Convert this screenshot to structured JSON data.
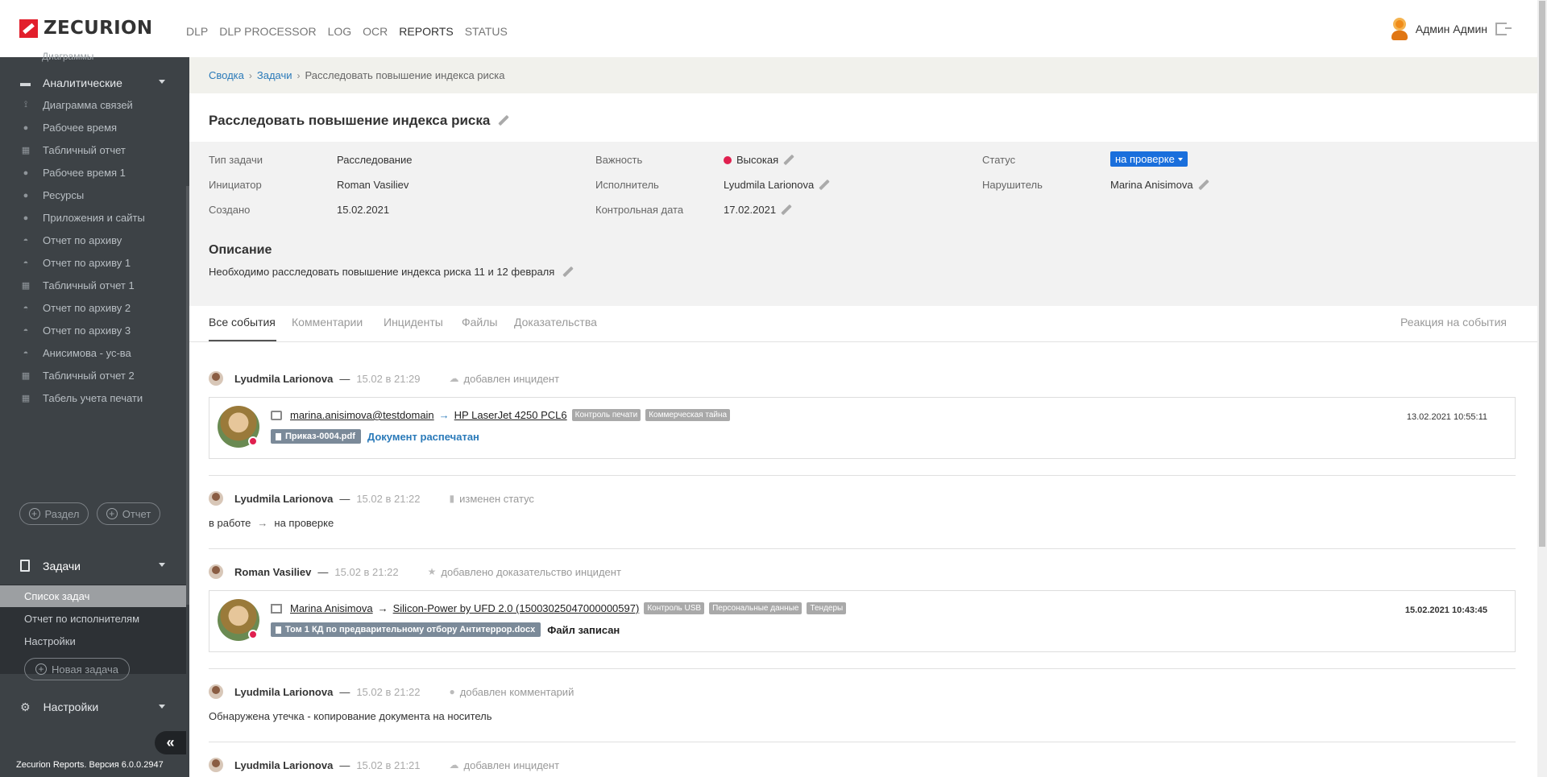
{
  "app": {
    "brand": "ZECURION",
    "brand_color": "#e21f2c"
  },
  "topnav": [
    "DLP",
    "DLP PROCESSOR",
    "LOG",
    "OCR",
    "REPORTS",
    "STATUS"
  ],
  "topnav_active": "REPORTS",
  "user": {
    "name": "Админ Админ"
  },
  "sidebar": {
    "cut_item": "Диаграммы",
    "group_analytics": "Аналитические",
    "items": [
      {
        "label": "Диаграмма связей",
        "icon": "graph-icon"
      },
      {
        "label": "Рабочее время",
        "icon": "clock-icon"
      },
      {
        "label": "Табличный отчет",
        "icon": "table-icon"
      },
      {
        "label": "Рабочее время 1",
        "icon": "clock-icon"
      },
      {
        "label": "Ресурсы",
        "icon": "users-icon"
      },
      {
        "label": "Приложения и сайты",
        "icon": "users-icon"
      },
      {
        "label": "Отчет по архиву",
        "icon": "archive-icon"
      },
      {
        "label": "Отчет по архиву 1",
        "icon": "archive-icon"
      },
      {
        "label": "Табличный отчет 1",
        "icon": "table-icon"
      },
      {
        "label": "Отчет по архиву 2",
        "icon": "archive-icon"
      },
      {
        "label": "Отчет по архиву 3",
        "icon": "archive-icon"
      },
      {
        "label": "Анисимова - ус-ва",
        "icon": "archive-icon"
      },
      {
        "label": "Табличный отчет 2",
        "icon": "table-icon"
      },
      {
        "label": "Табель учета печати",
        "icon": "grid-icon"
      }
    ],
    "add_section": "Раздел",
    "add_report": "Отчет",
    "tasks_group": "Задачи",
    "tasks_items": [
      "Список задач",
      "Отчет по исполнителям",
      "Настройки"
    ],
    "new_task": "Новая задача",
    "settings_group": "Настройки",
    "version": "Zecurion Reports. Версия 6.0.0.2947"
  },
  "breadcrumb": {
    "root": "Сводка",
    "parent": "Задачи",
    "current": "Расследовать повышение индекса риска"
  },
  "task": {
    "title": "Расследовать повышение индекса риска",
    "type_label": "Тип задачи",
    "type": "Расследование",
    "initiator_label": "Инициатор",
    "initiator": "Roman Vasiliev",
    "created_label": "Создано",
    "created": "15.02.2021",
    "priority_label": "Важность",
    "priority": "Высокая",
    "assignee_label": "Исполнитель",
    "assignee": "Lyudmila Larionova",
    "deadline_label": "Контрольная дата",
    "deadline": "17.02.2021",
    "status_label": "Статус",
    "status": "на проверке",
    "violator_label": "Нарушитель",
    "violator": "Marina Anisimova",
    "description_title": "Описание",
    "description": "Необходимо расследовать повышение индекса риска 11 и 12 февраля"
  },
  "tabs": [
    "Все события",
    "Комментарии",
    "Инциденты",
    "Файлы",
    "Доказательства"
  ],
  "tab_right": "Реакция на события",
  "events": [
    {
      "author": "Lyudmila Larionova",
      "time": "15.02 в 21:29",
      "action": "добавлен инцидент",
      "card": {
        "from": "marina.anisimova@testdomain",
        "to": "HP LaserJet 4250 PCL6",
        "tags": [
          "Контроль печати",
          "Коммерческая тайна"
        ],
        "file": "Приказ-0004.pdf",
        "result": "Документ распечатан",
        "date": "13.02.2021 10:55:11"
      }
    },
    {
      "author": "Lyudmila Larionova",
      "time": "15.02 в 21:22",
      "action": "изменен статус",
      "status_from": "в работе",
      "status_to": "на проверке"
    },
    {
      "author": "Roman Vasiliev",
      "time": "15.02 в 21:22",
      "action": "добавлено доказательство инцидент",
      "card": {
        "from": "Marina Anisimova",
        "to": "Silicon-Power by UFD 2.0 (15003025047000000597)",
        "tags": [
          "Контроль USB",
          "Персональные данные",
          "Тендеры"
        ],
        "file": "Том 1 КД по предварительному отбору Антитеррор.docx",
        "result": "Файл записан",
        "date": "15.02.2021 10:43:45"
      }
    },
    {
      "author": "Lyudmila Larionova",
      "time": "15.02 в 21:22",
      "action": "добавлен комментарий",
      "comment": "Обнаружена утечка - копирование документа на носитель"
    },
    {
      "author": "Lyudmila Larionova",
      "time": "15.02 в 21:21",
      "action": "добавлен инцидент"
    }
  ]
}
